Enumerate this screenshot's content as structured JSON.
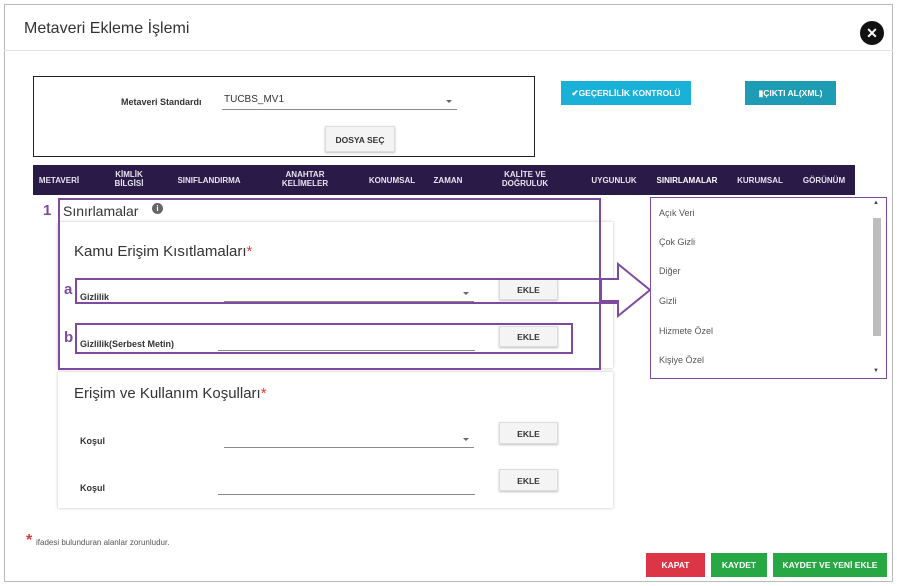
{
  "window": {
    "title": "Metaveri Ekleme İşlemi"
  },
  "standard": {
    "label": "Metaveri Standardı",
    "value": "TUCBS_MV1",
    "file_button": "DOSYA SEÇ"
  },
  "actions": {
    "validity": "GEÇERLİLİK KONTROLÜ",
    "output": "ÇIKTI AL(XML)"
  },
  "tabs": [
    {
      "label": "METAVERİ"
    },
    {
      "label": "KİMLİK\nBİLGİSİ"
    },
    {
      "label": "SINIFLANDIRMA"
    },
    {
      "label": "ANAHTAR\nKELİMELER"
    },
    {
      "label": "KONUMSAL"
    },
    {
      "label": "ZAMAN"
    },
    {
      "label": "KALİTE VE\nDOĞRULUK"
    },
    {
      "label": "UYGUNLUK"
    },
    {
      "label": "SINIRLAMALAR"
    },
    {
      "label": "KURUMSAL"
    },
    {
      "label": "GÖRÜNÜM"
    }
  ],
  "section": {
    "title": "Sınırlamalar",
    "info_icon": "info-icon"
  },
  "public_access": {
    "title": "Kamu Erişim Kısıtlamaları",
    "required_mark": "*",
    "row1_label": "Gizlilik",
    "row1_button": "EKLE",
    "row2_label": "Gizlilik(Serbest Metin)",
    "row2_button": "EKLE"
  },
  "access_use": {
    "title": "Erişim ve Kullanım Koşulları",
    "required_mark": "*",
    "row1_label": "Koşul",
    "row1_button": "EKLE",
    "row2_label": "Koşul",
    "row2_button": "EKLE"
  },
  "dropdown_options": [
    "Açık Veri",
    "Çok Gizli",
    "Diğer",
    "Gizli",
    "Hizmete Özel",
    "Kişiye Özel"
  ],
  "annotations": {
    "n1": "1",
    "a": "a",
    "b": "b"
  },
  "footnote": {
    "mark": "*",
    "text": " ifadesi bulunduran alanlar zorunludur."
  },
  "footer": {
    "close": "KAPAT",
    "save": "KAYDET",
    "save_new": "KAYDET VE YENİ EKLE"
  },
  "colors": {
    "nav_bg": "#2a1a48",
    "accent": "#1ab1d8",
    "danger": "#dc3545",
    "success": "#28a745",
    "annotation": "#7d4aa0"
  }
}
